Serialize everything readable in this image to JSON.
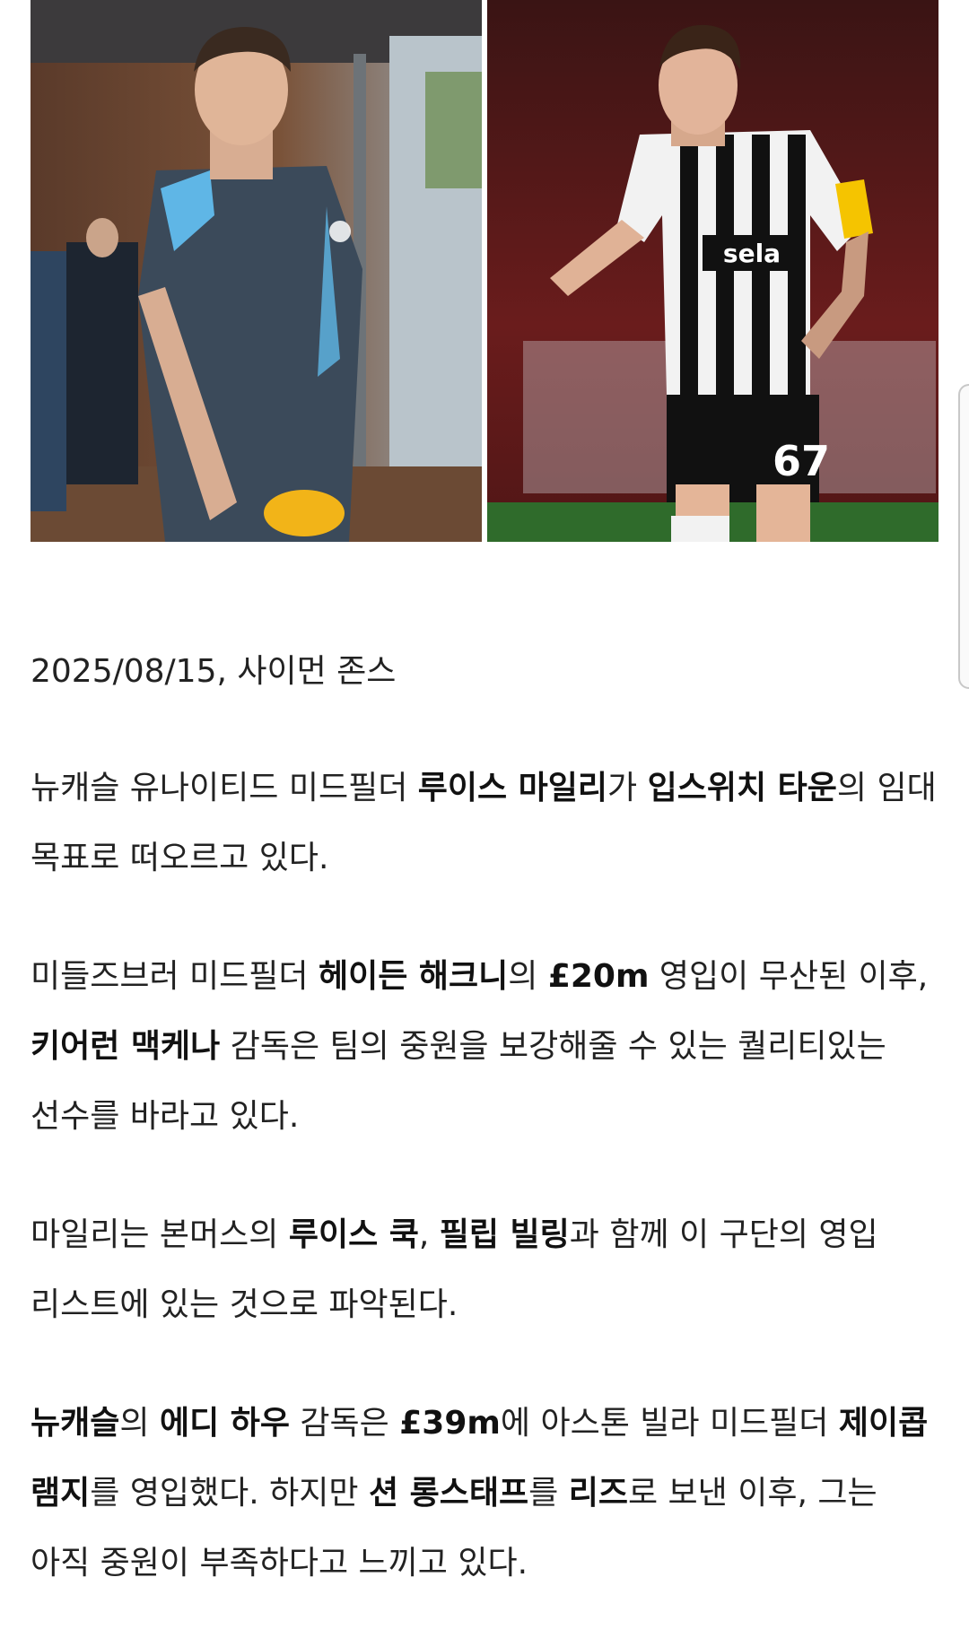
{
  "byline": "2025/08/15, 사이먼 존스",
  "paragraphs": [
    [
      {
        "t": "뉴캐슬 유나이티드 미드필더 "
      },
      {
        "t": "루이스 마일리",
        "b": true
      },
      {
        "t": "가 "
      },
      {
        "t": "입스위치 타운",
        "b": true
      },
      {
        "t": "의 임대 목표로 떠오르고 있다."
      }
    ],
    [
      {
        "t": "미들즈브러 미드필더 "
      },
      {
        "t": "헤이든 해크니",
        "b": true
      },
      {
        "t": "의 "
      },
      {
        "t": "£20m",
        "b": true
      },
      {
        "t": " 영입이 무산된 이후, "
      },
      {
        "t": "키어런 맥케나",
        "b": true
      },
      {
        "t": " 감독은 팀의 중원을 보강해줄 수 있는 퀄리티있는 선수를 바라고 있다."
      }
    ],
    [
      {
        "t": "마일리는 본머스의 "
      },
      {
        "t": "루이스 쿡",
        "b": true
      },
      {
        "t": ", "
      },
      {
        "t": "필립 빌링",
        "b": true
      },
      {
        "t": "과 함께 이 구단의 영입 리스트에 있는 것으로 파악된다."
      }
    ],
    [
      {
        "t": "뉴캐슬",
        "b": true
      },
      {
        "t": "의 "
      },
      {
        "t": "에디 하우",
        "b": true
      },
      {
        "t": " 감독은 "
      },
      {
        "t": "£39m",
        "b": true
      },
      {
        "t": "에 아스톤 빌라 미드필더 "
      },
      {
        "t": "제이콥 램지",
        "b": true
      },
      {
        "t": "를 영입했다. 하지만 "
      },
      {
        "t": "션 롱스태프",
        "b": true
      },
      {
        "t": "를 "
      },
      {
        "t": "리즈",
        "b": true
      },
      {
        "t": "로 보낸 이후, 그는 아직 중원이 부족하다고 느끼고 있다."
      }
    ]
  ],
  "photos": {
    "left": {
      "sponsor_badge": "",
      "colors": {
        "shirt": "#3b4a5a",
        "stripe": "#5fb6e6",
        "bottle": "#f2b418"
      }
    },
    "right": {
      "sponsor": "sela",
      "number": "67",
      "colors": {
        "stripe_dark": "#111111",
        "stripe_light": "#f2f2f2",
        "captain": "#f5c400",
        "pitch": "#2f6b2b"
      }
    }
  }
}
